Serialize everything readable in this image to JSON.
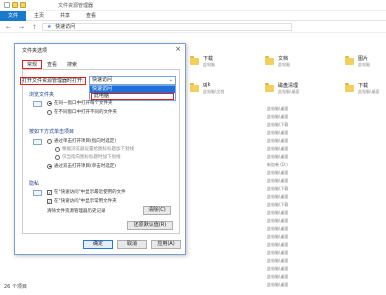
{
  "window": {
    "title": "文件资源管理器",
    "ribbon_tabs": [
      "文件",
      "主页",
      "共享",
      "查看"
    ],
    "address": "快速访问"
  },
  "content": {
    "folders": [
      {
        "name": "下载",
        "sub": "此电脑"
      },
      {
        "name": "文档",
        "sub": "此电脑"
      },
      {
        "name": "图片",
        "sub": "此电脑"
      },
      {
        "name": "gjk",
        "sub": "此电脑\\文档"
      },
      {
        "name": "磁盘清理",
        "sub": "此电脑\\桌面"
      },
      {
        "name": "下载",
        "sub": "此电脑\\桌面"
      }
    ],
    "recent_rows": [
      "此电脑\\桌面",
      "此电脑\\桌面",
      "此电脑\\下载",
      "此电脑\\桌面",
      "此电脑\\桌面",
      "此电脑\\桌面",
      "此电脑\\桌面",
      "新加卷 (D:)",
      "此电脑\\桌面",
      "此电脑\\桌面",
      "此电脑\\下载",
      "此电脑\\桌面",
      "此电脑\\下载",
      "此电脑\\桌面",
      "此电脑\\桌面",
      "此电脑\\桌面",
      "此电脑\\桌面",
      "此电脑\\桌面",
      "此电脑\\桌面",
      "此电脑\\桌面",
      "此电脑\\桌面",
      "此电脑\\桌面",
      "此电脑\\桌面"
    ]
  },
  "status_bar": "26 个项目",
  "dialog": {
    "title": "文件夹选项",
    "close": "×",
    "tabs": [
      "常规",
      "查看",
      "搜索"
    ],
    "open_label": "打开文件资源管理器时打开:",
    "select_value": "快速访问",
    "select_options": [
      "快速访问",
      "此电脑"
    ],
    "browse_section": "浏览文件夹",
    "browse_opt1": "在同一窗口中打开每个文件夹",
    "browse_opt2": "在不同窗口中打开不同的文件夹",
    "click_section": "按如下方式单击项目",
    "click_opt1": "通过单击打开项目(指向时选定)",
    "click_sub1": "根据浏览器设置给图标标题加下划线",
    "click_sub2": "仅当指向图标标题时加下划线",
    "click_opt2": "通过双击打开项目(单击时选定)",
    "privacy_section": "隐私",
    "privacy_chk1": "在\"快速访问\"中显示最近使用的文件",
    "privacy_chk2": "在\"快速访问\"中显示常用文件夹",
    "clear_history_label": "清除文件资源管理器历史记录",
    "clear_button": "清除(C)",
    "restore_button": "还原默认值(R)",
    "ok": "确定",
    "cancel": "取消",
    "apply": "应用(A)"
  }
}
